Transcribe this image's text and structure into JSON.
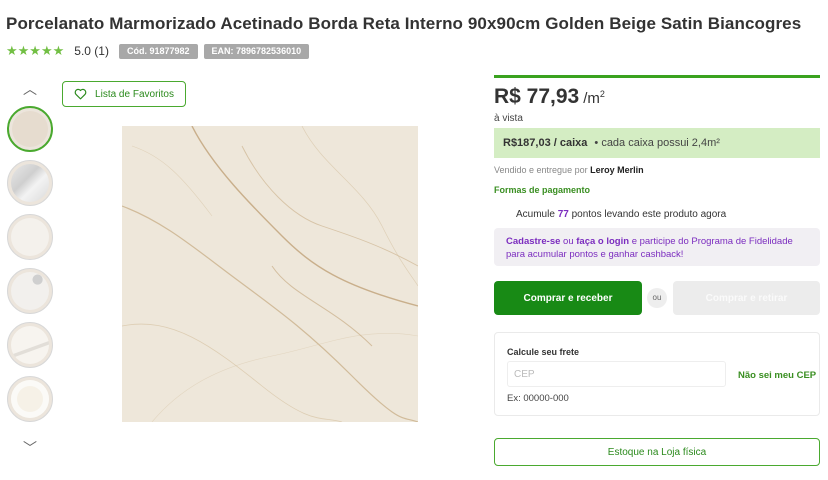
{
  "product": {
    "title": "Porcelanato Marmorizado Acetinado Borda Reta Interno 90x90cm Golden Beige Satin Biancogres",
    "rating_stars": "★★★★★",
    "rating_value": "5.0 (1)",
    "code_badge": "Cód. 91877982",
    "ean_badge": "EAN: 7896782536010"
  },
  "gallery": {
    "favorites_label": "Lista de Favoritos",
    "up_arrow": "︿",
    "down_arrow": "﹀"
  },
  "pricing": {
    "price": "R$ 77,93",
    "unit": "/m",
    "unit_sup": "2",
    "cash_note": "à vista",
    "box_price": "R$187,03 / caixa",
    "box_note": "• cada caixa possui 2,4m²"
  },
  "seller": {
    "prefix": "Vendido e entregue por",
    "name": "Leroy Merlin"
  },
  "payment_link": "Formas de pagamento",
  "points": {
    "prefix": "Acumule",
    "value": "77",
    "suffix": "pontos levando este produto agora"
  },
  "loyalty": {
    "signup": "Cadastre-se",
    "or": "ou",
    "login": "faça o login",
    "rest": "e participe do Programa de Fidelidade para acumular pontos e ganhar cashback!"
  },
  "actions": {
    "buy_label": "Comprar e receber",
    "or_label": "ou",
    "pickup_label": "Comprar e retirar"
  },
  "shipping": {
    "title": "Calcule seu frete",
    "placeholder": "CEP",
    "unknown_cep_link": "Não sei meu CEP",
    "example": "Ex: 00000-000"
  },
  "stock_label": "Estoque na Loja física",
  "colors": {
    "brand_green": "#188a15",
    "light_green": "#d4edc3",
    "loyalty_purple": "#7b2cbf",
    "tile_beige": "#ece4d6"
  }
}
